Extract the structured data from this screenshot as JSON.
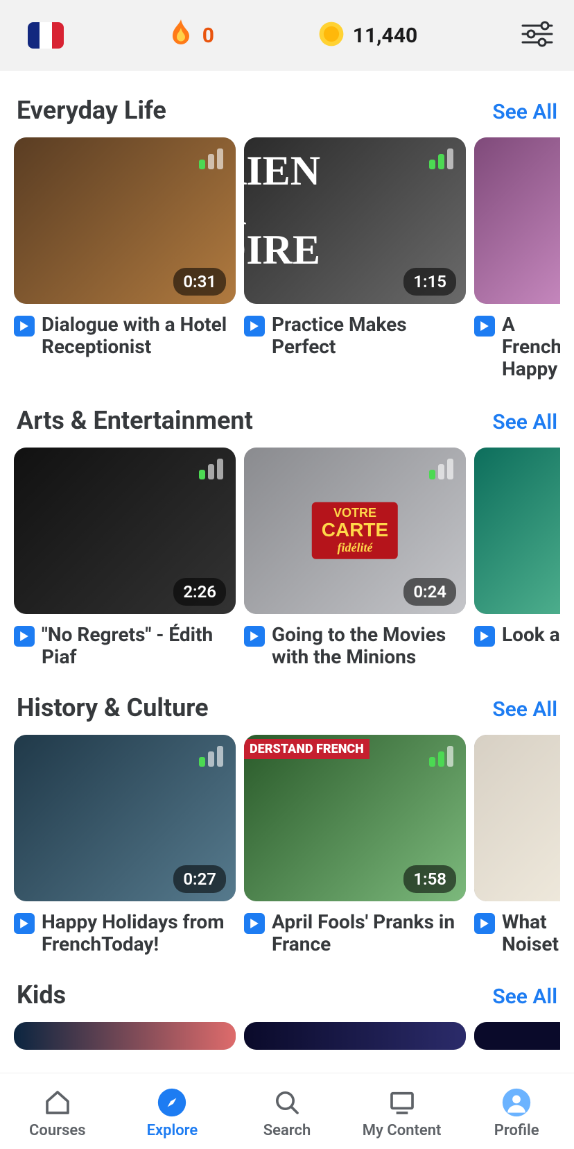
{
  "header": {
    "streak_count": "0",
    "coin_count": "11,440"
  },
  "sections": [
    {
      "title": "Everyday Life",
      "see_all": "See All",
      "cards": [
        {
          "title": "Dialogue with a Hotel Receptionist",
          "duration": "0:31",
          "signal": 1
        },
        {
          "title": "Practice Makes Perfect",
          "duration": "1:15",
          "signal": 2
        },
        {
          "title": "A French Happy",
          "duration": "",
          "signal": 0
        }
      ]
    },
    {
      "title": "Arts & Entertainment",
      "see_all": "See All",
      "cards": [
        {
          "title": "\"No Regrets\" - Édith Piaf",
          "duration": "2:26",
          "signal": 1
        },
        {
          "title": "Going to the Movies with the Minions",
          "duration": "0:24",
          "signal": 1
        },
        {
          "title": "Look a",
          "duration": "",
          "signal": 0
        }
      ]
    },
    {
      "title": "History & Culture",
      "see_all": "See All",
      "cards": [
        {
          "title": "Happy Holidays from FrenchToday!",
          "duration": "0:27",
          "signal": 1
        },
        {
          "title": "April Fools' Pranks in France",
          "duration": "1:58",
          "signal": 2
        },
        {
          "title": "What Noiset",
          "duration": "",
          "signal": 0
        }
      ]
    },
    {
      "title": "Kids",
      "see_all": "See All",
      "cards": [
        {
          "title": "",
          "duration": "",
          "signal": 0
        },
        {
          "title": "",
          "duration": "",
          "signal": 0
        },
        {
          "title": "",
          "duration": "",
          "signal": 0
        }
      ]
    }
  ],
  "nav": {
    "courses": "Courses",
    "explore": "Explore",
    "search": "Search",
    "my_content": "My Content",
    "profile": "Profile"
  }
}
